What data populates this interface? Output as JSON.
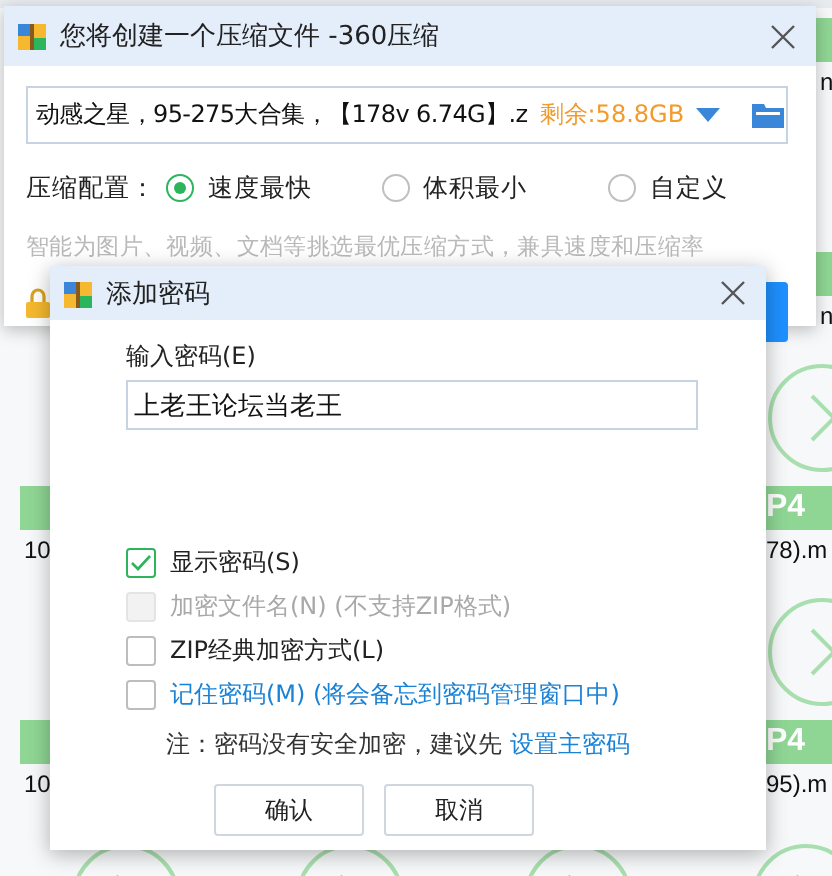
{
  "background": {
    "tiles": [
      {
        "kind": "video",
        "label": "n"
      },
      {
        "kind": "video",
        "label": "n"
      },
      {
        "kind": "video",
        "label": "10"
      },
      {
        "kind": "video",
        "badge": "P4",
        "label": "78).m"
      },
      {
        "kind": "video",
        "label": "10"
      },
      {
        "kind": "video",
        "badge": "P4",
        "label": "95).m"
      },
      {
        "kind": "video"
      },
      {
        "kind": "video"
      },
      {
        "kind": "video"
      },
      {
        "kind": "video"
      }
    ]
  },
  "window": {
    "title": "您将创建一个压缩文件 -360压缩",
    "path": {
      "value": "动感之星，95-275大合集，【178v 6.74G】.z",
      "free_space": "剩余:58.8GB"
    },
    "config": {
      "label": "压缩配置：",
      "options": [
        {
          "label": "速度最快",
          "selected": true
        },
        {
          "label": "体积最小",
          "selected": false
        },
        {
          "label": "自定义",
          "selected": false
        }
      ]
    },
    "hint": "智能为图片、视频、文档等挑选最优压缩方式，兼具速度和压缩率"
  },
  "dialog": {
    "title": "添加密码",
    "password_label": "输入密码(E)",
    "password": "上老王论坛当老王",
    "options": [
      {
        "kind": "plain",
        "label": "显示密码(S)",
        "checked": true,
        "disabled": false
      },
      {
        "kind": "plain",
        "label": "加密文件名(N) (不支持ZIP格式)",
        "checked": false,
        "disabled": true
      },
      {
        "kind": "plain",
        "label": "ZIP经典加密方式(L)",
        "checked": false,
        "disabled": false
      },
      {
        "kind": "link",
        "label": "记住密码(M) (将会备忘到密码管理窗口中)",
        "checked": false,
        "disabled": false
      }
    ],
    "note": "注：密码没有安全加密，建议先",
    "note_link": "设置主密码",
    "buttons": [
      "确认",
      "取消"
    ]
  }
}
